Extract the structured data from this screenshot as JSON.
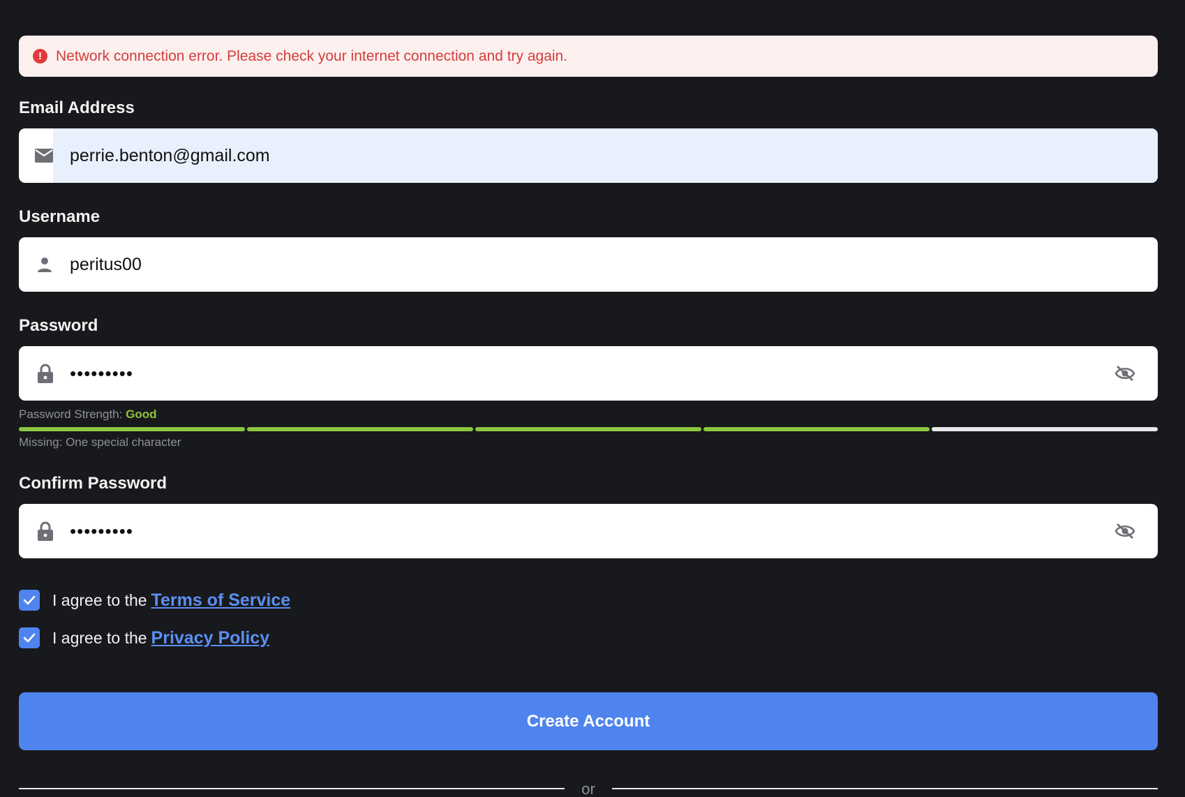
{
  "error": {
    "icon": "alert-circle-icon",
    "message": "Network connection error. Please check your internet connection and try again."
  },
  "fields": {
    "email": {
      "label": "Email Address",
      "icon": "mail-icon",
      "value": "perrie.benton@gmail.com"
    },
    "username": {
      "label": "Username",
      "icon": "user-icon",
      "value": "peritus00"
    },
    "password": {
      "label": "Password",
      "icon": "lock-icon",
      "value": "•••••••••",
      "toggle_icon": "eye-off-icon"
    },
    "confirm_password": {
      "label": "Confirm Password",
      "icon": "lock-icon",
      "value": "•••••••••",
      "toggle_icon": "eye-off-icon"
    }
  },
  "strength": {
    "prefix": "Password Strength:",
    "value": "Good",
    "filled_segments": 4,
    "total_segments": 5,
    "missing": "Missing: One special character"
  },
  "agreements": [
    {
      "prefix": "I agree to the",
      "link": "Terms of Service",
      "checked": true
    },
    {
      "prefix": "I agree to the",
      "link": "Privacy Policy",
      "checked": true
    }
  ],
  "submit_label": "Create Account",
  "divider_text": "or",
  "colors": {
    "background": "#18191c",
    "accent": "#4f84ee",
    "error_bg": "#fcf0ef",
    "error_text": "#d23d3d",
    "strength_good": "#8cc63e",
    "autofill_bg": "#e8f0fd"
  }
}
